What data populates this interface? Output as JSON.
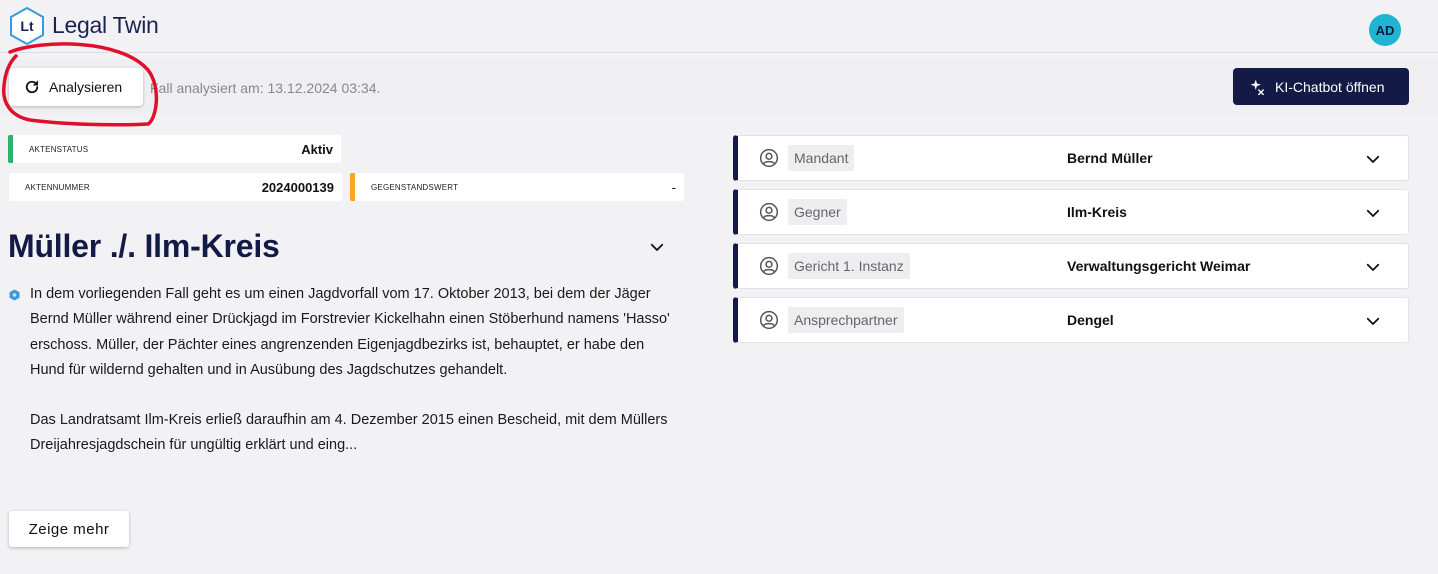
{
  "header": {
    "logo_text": "Lt",
    "brand": "Legal Twin",
    "avatar_initials": "AD"
  },
  "toolbar": {
    "analyze_label": "Analysieren",
    "analyzed_text": "Fall analysiert am: 13.12.2024 03:34.",
    "chatbot_label": "KI-Chatbot öffnen"
  },
  "info": {
    "status_label": "AKTENSTATUS",
    "status_value": "Aktiv",
    "file_number_label": "AKTENNUMMER",
    "file_number_value": "2024000139",
    "value_label": "GEGENSTANDSWERT",
    "value_value": "-"
  },
  "case": {
    "title": "Müller ./. Ilm-Kreis",
    "paragraph_1": "In dem vorliegenden Fall geht es um einen Jagdvorfall vom 17. Oktober 2013, bei dem der Jäger Bernd Müller während einer Drückjagd im Forstrevier Kickelhahn einen Stöberhund namens 'Hasso' erschoss. Müller, der Pächter eines angrenzenden Eigenjagdbezirks ist, behauptet, er habe den Hund für wildernd gehalten und in Ausübung des Jagdschutzes gehandelt.",
    "paragraph_2": "Das Landratsamt Ilm-Kreis erließ daraufhin am 4. Dezember 2015 einen Bescheid, mit dem Müllers Dreijahresjagdschein für ungültig erklärt und eing...",
    "more_label": "Zeige mehr"
  },
  "parties": [
    {
      "role": "Mandant",
      "name": "Bernd Müller"
    },
    {
      "role": "Gegner",
      "name": "Ilm-Kreis"
    },
    {
      "role": "Gericht 1. Instanz",
      "name": "Verwaltungsgericht Weimar"
    },
    {
      "role": "Ansprechpartner",
      "name": "Dengel"
    }
  ],
  "colors": {
    "navy": "#121a45",
    "status_green": "#2bb36a",
    "value_orange": "#f5a623",
    "avatar": "#1fb4d2",
    "annotation_red": "#e0102c"
  },
  "icons": [
    "refresh-icon",
    "sparkle-icon",
    "chevron-down-icon",
    "user-circle-icon",
    "ai-hexagon-icon"
  ]
}
